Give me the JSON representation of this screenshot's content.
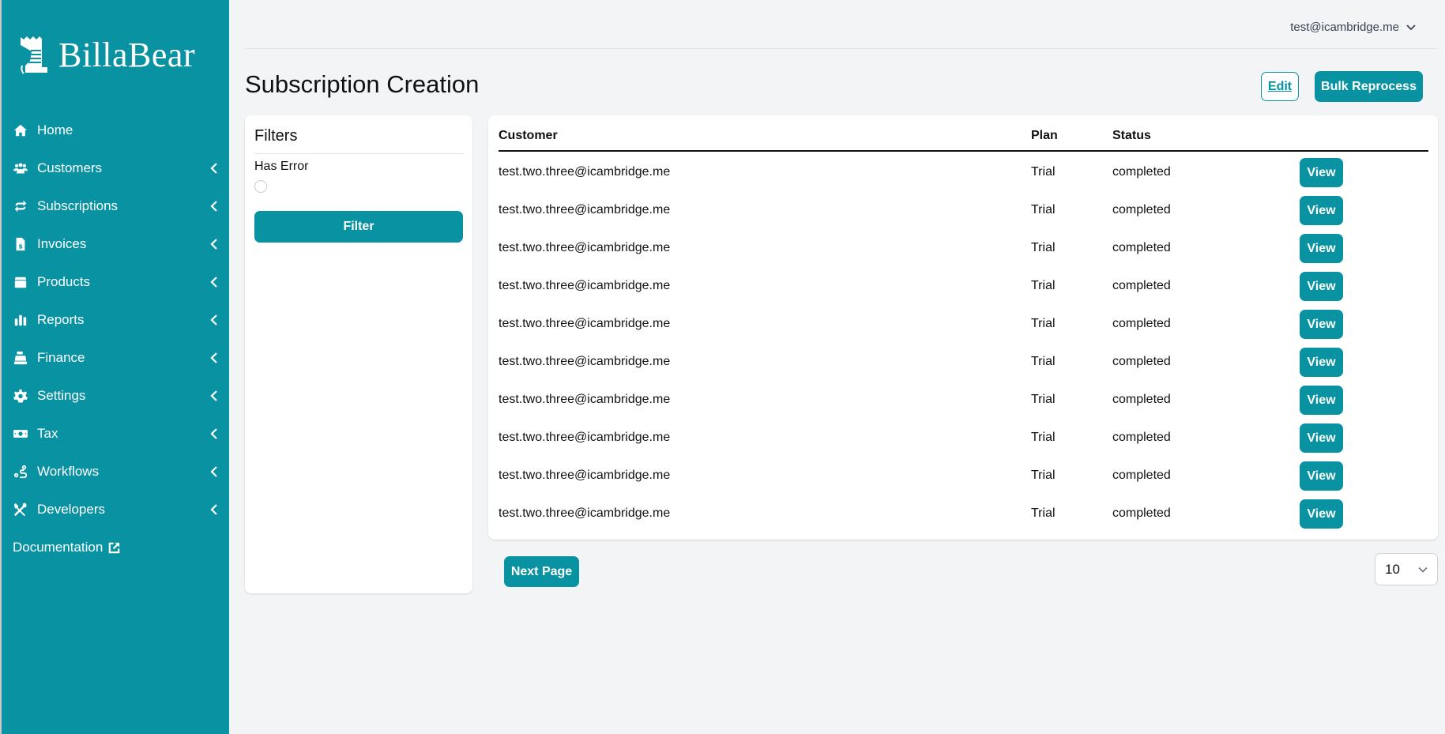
{
  "brand": {
    "name": "BillaBear",
    "accent": "#0892a2"
  },
  "sidebar": {
    "items": [
      {
        "label": "Home",
        "icon": "home-icon",
        "expandable": false
      },
      {
        "label": "Customers",
        "icon": "users-icon",
        "expandable": true
      },
      {
        "label": "Subscriptions",
        "icon": "repeat-icon",
        "expandable": true
      },
      {
        "label": "Invoices",
        "icon": "invoice-icon",
        "expandable": true
      },
      {
        "label": "Products",
        "icon": "box-icon",
        "expandable": true
      },
      {
        "label": "Reports",
        "icon": "bar-chart-icon",
        "expandable": true
      },
      {
        "label": "Finance",
        "icon": "cash-register-icon",
        "expandable": true
      },
      {
        "label": "Settings",
        "icon": "gear-icon",
        "expandable": true
      },
      {
        "label": "Tax",
        "icon": "money-bill-icon",
        "expandable": true
      },
      {
        "label": "Workflows",
        "icon": "route-icon",
        "expandable": true
      },
      {
        "label": "Developers",
        "icon": "tools-icon",
        "expandable": true
      }
    ],
    "documentation": {
      "label": "Documentation",
      "icon": "external-link-icon"
    }
  },
  "header": {
    "user_email": "test@icambridge.me"
  },
  "page": {
    "title": "Subscription Creation",
    "edit_label": "Edit",
    "bulk_reprocess_label": "Bulk Reprocess"
  },
  "filters": {
    "title": "Filters",
    "has_error_label": "Has Error",
    "has_error_checked": false,
    "filter_button_label": "Filter"
  },
  "table": {
    "columns": [
      "Customer",
      "Plan",
      "Status"
    ],
    "rows": [
      {
        "customer": "test.two.three@icambridge.me",
        "plan": "Trial",
        "status": "completed",
        "action": "View"
      },
      {
        "customer": "test.two.three@icambridge.me",
        "plan": "Trial",
        "status": "completed",
        "action": "View"
      },
      {
        "customer": "test.two.three@icambridge.me",
        "plan": "Trial",
        "status": "completed",
        "action": "View"
      },
      {
        "customer": "test.two.three@icambridge.me",
        "plan": "Trial",
        "status": "completed",
        "action": "View"
      },
      {
        "customer": "test.two.three@icambridge.me",
        "plan": "Trial",
        "status": "completed",
        "action": "View"
      },
      {
        "customer": "test.two.three@icambridge.me",
        "plan": "Trial",
        "status": "completed",
        "action": "View"
      },
      {
        "customer": "test.two.three@icambridge.me",
        "plan": "Trial",
        "status": "completed",
        "action": "View"
      },
      {
        "customer": "test.two.three@icambridge.me",
        "plan": "Trial",
        "status": "completed",
        "action": "View"
      },
      {
        "customer": "test.two.three@icambridge.me",
        "plan": "Trial",
        "status": "completed",
        "action": "View"
      },
      {
        "customer": "test.two.three@icambridge.me",
        "plan": "Trial",
        "status": "completed",
        "action": "View"
      }
    ]
  },
  "pagination": {
    "next_label": "Next Page",
    "page_size": "10"
  }
}
